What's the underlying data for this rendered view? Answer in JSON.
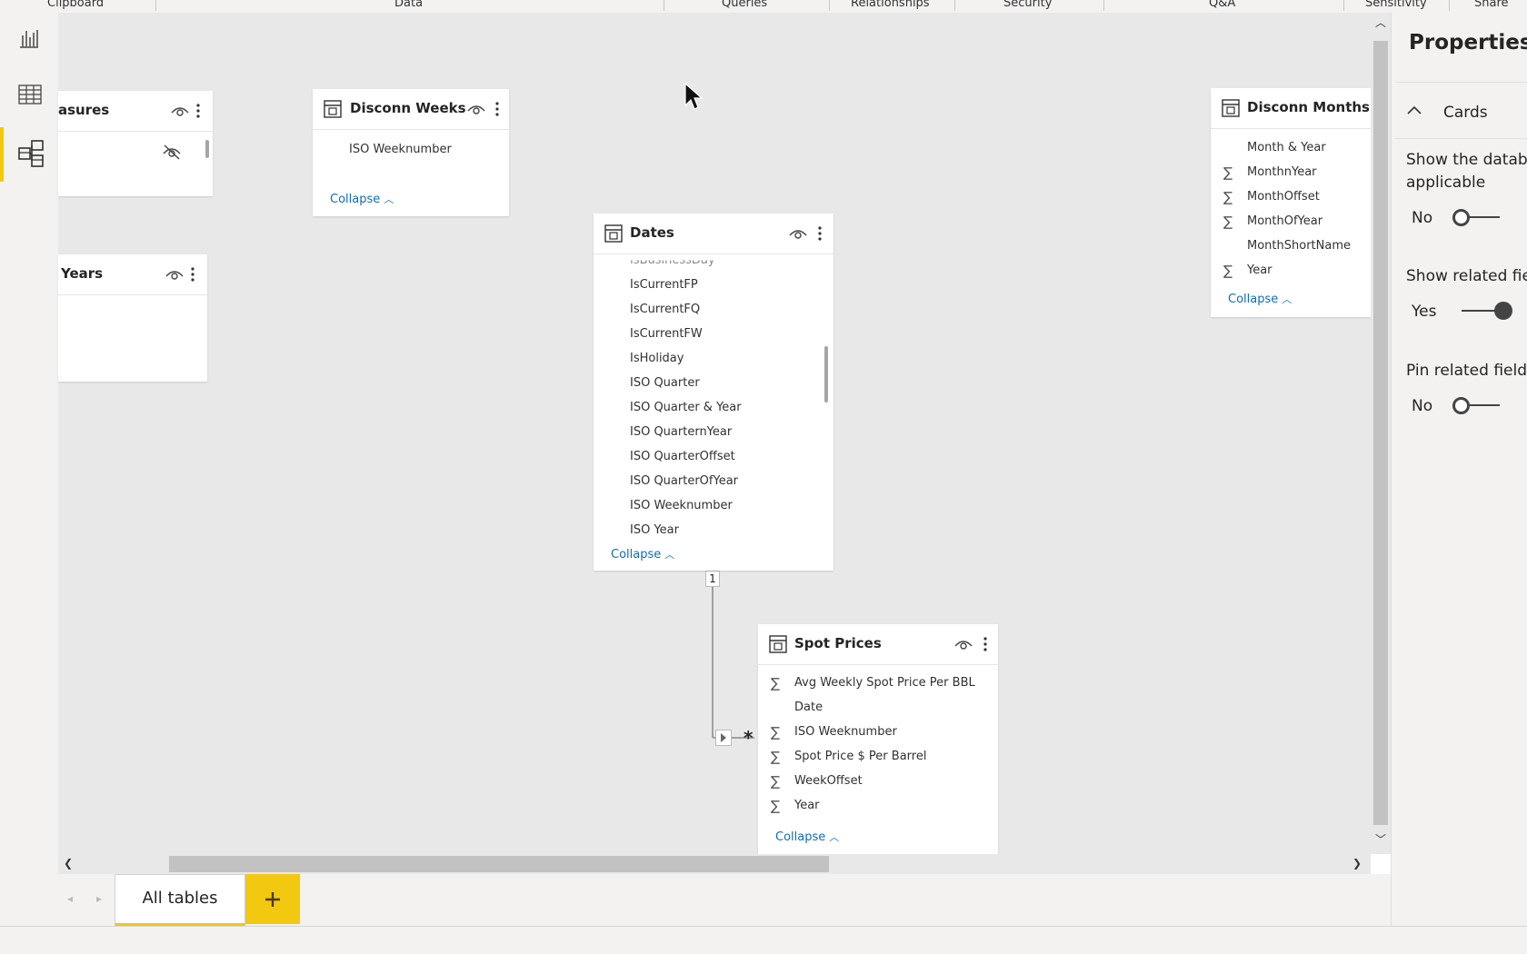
{
  "ribbon": {
    "groups": [
      "Clipboard",
      "Data",
      "Queries",
      "Relationships",
      "Security",
      "Q&A",
      "Sensitivity",
      "Share"
    ]
  },
  "rail": {
    "items": [
      "report-view-icon",
      "data-view-icon",
      "model-view-icon"
    ],
    "active": "model-view-icon"
  },
  "tables": {
    "measures": {
      "title": "asures"
    },
    "years": {
      "title": "Years"
    },
    "disconn_weeks": {
      "title": "Disconn Weeks",
      "fields": [
        "ISO Weeknumber"
      ],
      "collapse": "Collapse"
    },
    "dates": {
      "title": "Dates",
      "partial_field": "IsBusinessDay",
      "fields": [
        "IsCurrentFP",
        "IsCurrentFQ",
        "IsCurrentFW",
        "IsHoliday",
        "ISO Quarter",
        "ISO Quarter & Year",
        "ISO QuarternYear",
        "ISO QuarterOffset",
        "ISO QuarterOfYear",
        "ISO Weeknumber",
        "ISO Year"
      ],
      "collapse": "Collapse"
    },
    "disconn_months": {
      "title": "Disconn Months",
      "fields": [
        {
          "name": "Month & Year",
          "sigma": false
        },
        {
          "name": "MonthnYear",
          "sigma": true
        },
        {
          "name": "MonthOffset",
          "sigma": true
        },
        {
          "name": "MonthOfYear",
          "sigma": true
        },
        {
          "name": "MonthShortName",
          "sigma": false
        },
        {
          "name": "Year",
          "sigma": true
        }
      ],
      "collapse": "Collapse"
    },
    "spot_prices": {
      "title": "Spot Prices",
      "fields": [
        {
          "name": "Avg Weekly Spot Price Per BBL",
          "sigma": true
        },
        {
          "name": "Date",
          "sigma": false
        },
        {
          "name": "ISO Weeknumber",
          "sigma": true
        },
        {
          "name": "Spot Price $ Per Barrel",
          "sigma": true
        },
        {
          "name": "WeekOffset",
          "sigma": true
        },
        {
          "name": "Year",
          "sigma": true
        }
      ],
      "collapse": "Collapse"
    }
  },
  "relationship": {
    "one_side": "1",
    "many_side": "*"
  },
  "properties": {
    "title": "Properties",
    "section": "Cards",
    "show_database_label": "Show the databa",
    "show_database_label_2": "applicable",
    "show_database_value": "No",
    "show_related_label": "Show related fie",
    "show_related_value": "Yes",
    "pin_related_label": "Pin related fields",
    "pin_related_value": "No"
  },
  "tabs": {
    "all_tables": "All tables",
    "add": "+"
  },
  "colors": {
    "accent": "#f2c811",
    "link": "#0f6cbd"
  }
}
